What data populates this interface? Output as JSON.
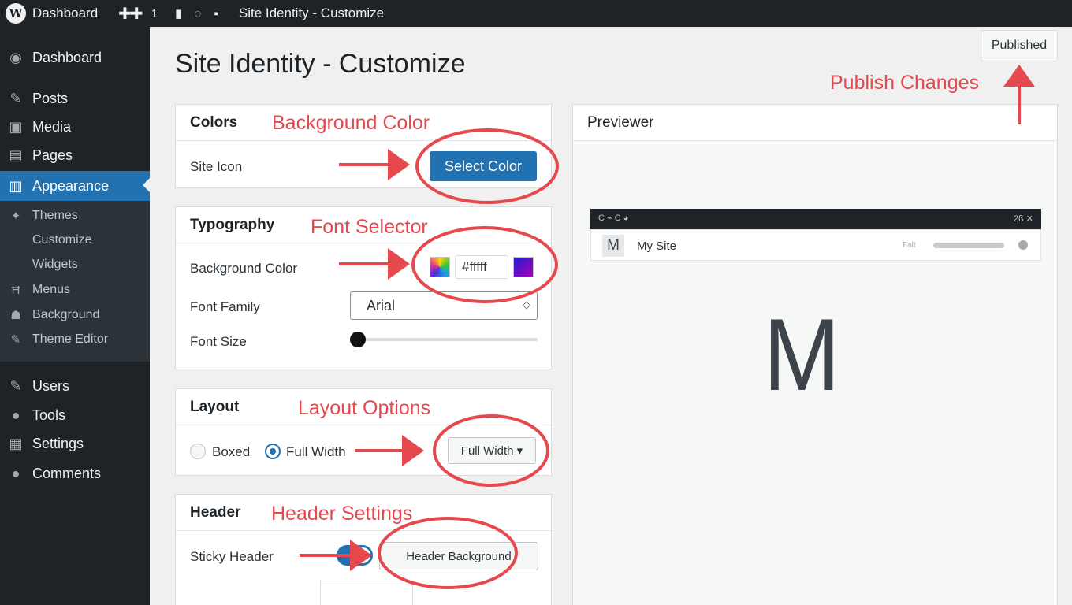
{
  "admin_bar": {
    "logo_glyph": "W",
    "dashboard_label": "Dashboard",
    "new_glyph": "✚✚",
    "updates_count": "1",
    "tool_icons": "▮ ◌ ▪",
    "page_title": "Site Identity - Customize"
  },
  "sidebar": {
    "items": [
      {
        "label": "Dashboard",
        "icon": "dashboard-icon",
        "glyph": "◉"
      },
      {
        "label": "Posts",
        "icon": "pin-icon",
        "glyph": "✎"
      },
      {
        "label": "Media",
        "icon": "media-icon",
        "glyph": "▣"
      },
      {
        "label": "Pages",
        "icon": "pages-icon",
        "glyph": "▤"
      },
      {
        "label": "Appearance",
        "icon": "appearance-icon",
        "glyph": "▥"
      },
      {
        "label": "Users",
        "icon": "users-icon",
        "glyph": "✎"
      },
      {
        "label": "Tools",
        "icon": "tools-icon",
        "glyph": "●"
      },
      {
        "label": "Settings",
        "icon": "settings-icon",
        "glyph": "▦"
      },
      {
        "label": "Comments",
        "icon": "comments-icon",
        "glyph": "●"
      }
    ],
    "submenu": [
      {
        "label": "Themes",
        "icon": "themes-icon",
        "glyph": "✦"
      },
      {
        "label": "Customize"
      },
      {
        "label": "Widgets"
      },
      {
        "label": "Menus",
        "icon": "menus-icon",
        "glyph": "Ħ"
      },
      {
        "label": "Background",
        "icon": "background-icon",
        "glyph": "☗"
      },
      {
        "label": "Theme Editor",
        "icon": "editor-icon",
        "glyph": "✎"
      }
    ]
  },
  "page": {
    "title": "Site Identity - Customize",
    "publish_label": "Published"
  },
  "colors_panel": {
    "heading": "Colors",
    "row_label": "Site Icon",
    "button_label": "Select Color"
  },
  "typography_panel": {
    "heading": "Typography",
    "bg_label": "Background Color",
    "hex_value": "#fffff",
    "font_family_label": "Font Family",
    "font_family_value": "Arial",
    "font_size_label": "Font Size",
    "font_size_level": 0
  },
  "layout_panel": {
    "heading": "Layout",
    "option_boxed": "Boxed",
    "option_full": "Full Width",
    "selected": "Full Width",
    "dropdown_label": "Full Width ▾"
  },
  "header_panel": {
    "heading": "Header",
    "sticky_label": "Sticky Header",
    "sticky_on": true,
    "bg_button_label": "Header Background"
  },
  "previewer": {
    "heading": "Previewer",
    "bar_left": "C ⌁ C ◕",
    "bar_right": "2ß ✕",
    "site_logo": "M",
    "site_name": "My Site",
    "header_hint": "Falt",
    "big_logo": "M"
  },
  "annotations": {
    "background_color": "Background Color",
    "font_selector": "Font Selector",
    "layout_options": "Layout Options",
    "header_settings": "Header Settings",
    "publish_changes": "Publish Changes"
  },
  "colors": {
    "accent": "#2271b1",
    "sidebar": "#1d2327",
    "annotation": "#e5484d"
  }
}
